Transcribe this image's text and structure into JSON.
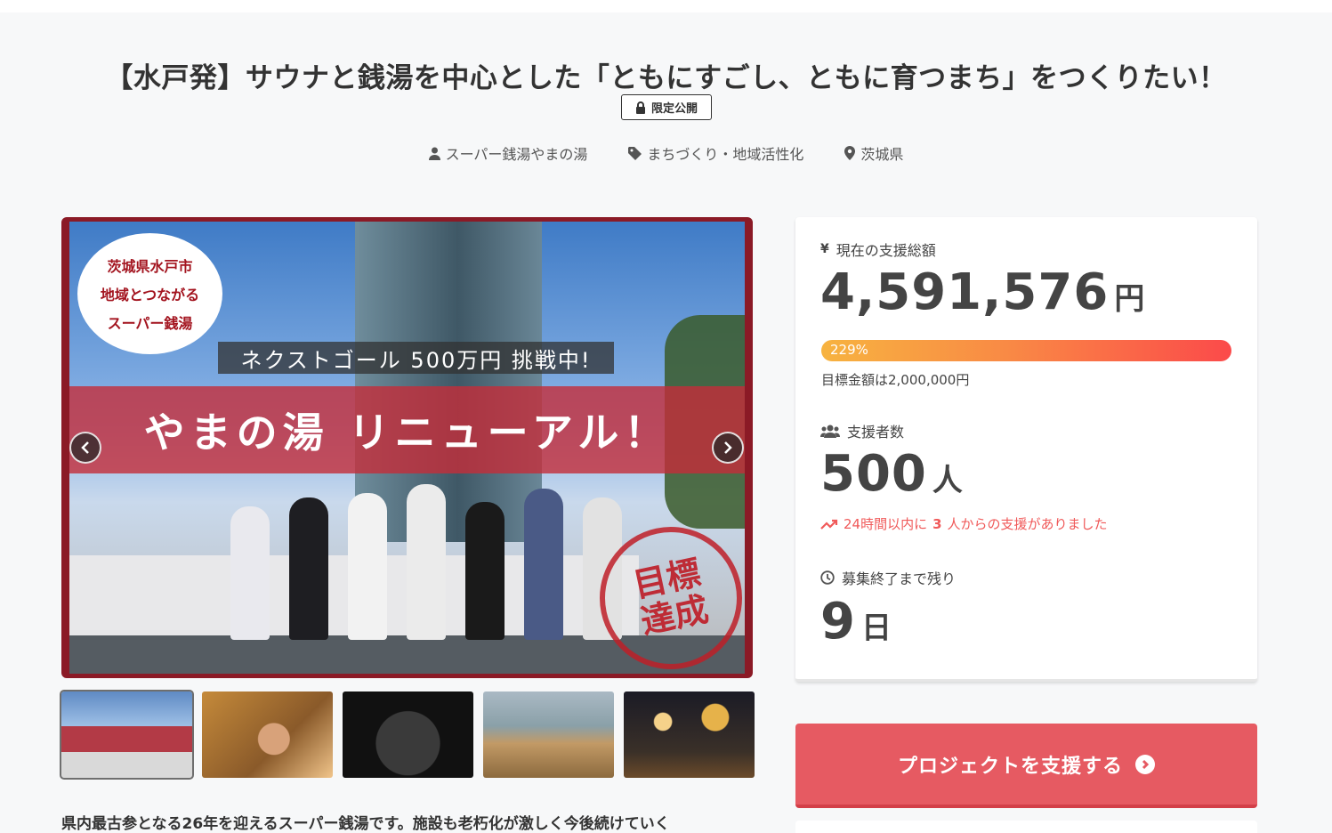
{
  "project": {
    "title": "【水戸発】サウナと銭湯を中心とした「ともにすごし、ともに育つまち」をつくりたい！",
    "badge": "限定公開",
    "meta": {
      "owner": "スーパー銭湯やまの湯",
      "category": "まちづくり・地域活性化",
      "location": "茨城県"
    }
  },
  "hero": {
    "circle_lines": [
      "茨城県水戸市",
      "地域とつながる",
      "スーパー銭湯"
    ],
    "next_goal": "ネクストゴール 500万円 挑戦中!",
    "banner": "やまの湯 リニューアル！",
    "stamp_lines": [
      "目標",
      "達成"
    ]
  },
  "thumbnails": [
    "thumb-1",
    "thumb-2",
    "thumb-3",
    "thumb-4",
    "thumb-5"
  ],
  "description": "県内最古参となる26年を迎えるスーパー銭湯です。施設も老朽化が激しく今後続けていく",
  "stats": {
    "funding_label": "現在の支援総額",
    "funding_amount": "4,591,576",
    "funding_unit": "円",
    "progress_text": "229%",
    "progress_percent": 229,
    "goal_text": "目標金額は2,000,000円",
    "supporters_label": "支援者数",
    "supporters_count": "500",
    "supporters_unit": "人",
    "trend_prefix": "24時間以内に",
    "trend_count": "3",
    "trend_suffix": "人からの支援がありました",
    "remaining_label": "募集終了まで残り",
    "remaining_days": "9",
    "remaining_unit": "日",
    "icons": {
      "funding": "yen-icon",
      "supporters": "users-icon",
      "trend": "trending-up-icon",
      "remaining": "clock-icon"
    },
    "accent_color": "#f05a5a"
  },
  "cta": {
    "label": "プロジェクトを支援する",
    "color": "#e65a62"
  }
}
